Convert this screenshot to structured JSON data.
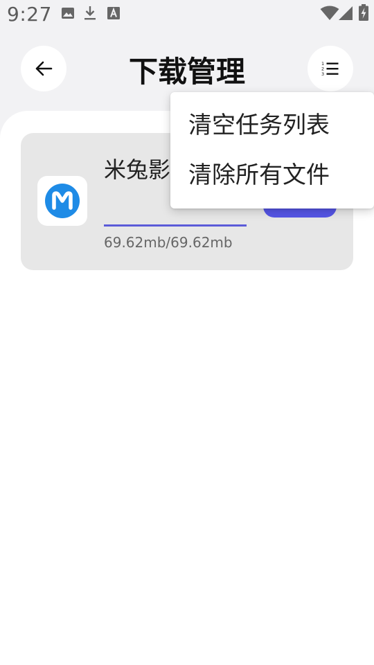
{
  "status_bar": {
    "time": "9:27",
    "left_icons": [
      "image-icon",
      "download-icon",
      "font-icon"
    ],
    "right_icons": [
      "wifi-icon",
      "signal-icon",
      "battery-charging-icon"
    ]
  },
  "header": {
    "title": "下载管理",
    "back_icon": "arrow-left-icon",
    "menu_icon": "numbered-list-icon"
  },
  "downloads": [
    {
      "name": "米兔影视.apk",
      "size_text": "69.62mb/69.62mb",
      "progress": 1.0,
      "icon": "mitu-app-icon"
    }
  ],
  "popup_menu": {
    "items": [
      "清空任务列表",
      "清除所有文件"
    ]
  },
  "colors": {
    "accent": "#5555e6",
    "app_icon_blue": "#1e8be6",
    "background": "#f2f2f4",
    "card": "#e7e7e7"
  }
}
